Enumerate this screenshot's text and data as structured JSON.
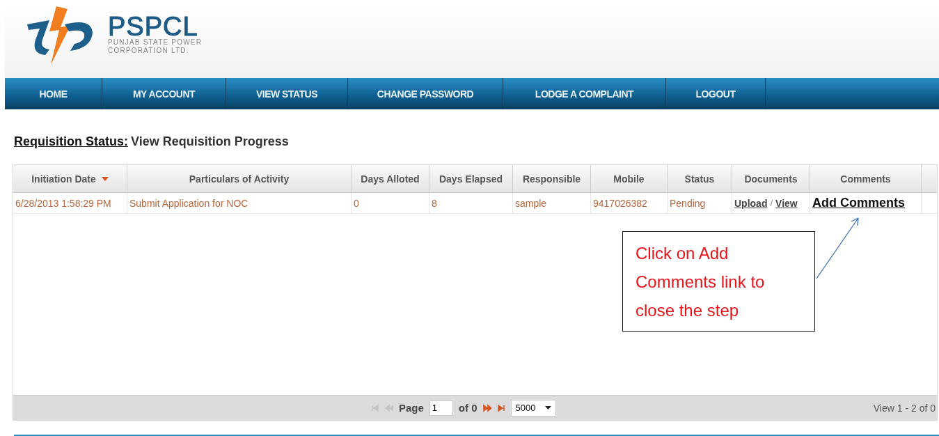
{
  "logo": {
    "name": "PSPCL",
    "subtitle_lines": [
      "PUNJAB STATE POWER",
      "CORPORATION LTD."
    ]
  },
  "nav": [
    {
      "label": "HOME"
    },
    {
      "label": "MY ACCOUNT"
    },
    {
      "label": "VIEW STATUS"
    },
    {
      "label": "CHANGE PASSWORD"
    },
    {
      "label": "LODGE A COMPLAINT"
    },
    {
      "label": "LOGOUT"
    }
  ],
  "page_title": {
    "label": "Requisition Status:",
    "text": "View Requisition Progress"
  },
  "table": {
    "columns": [
      {
        "label": "Initiation Date",
        "sorted": true
      },
      {
        "label": "Particulars of Activity",
        "sorted": false
      },
      {
        "label": "Days Alloted",
        "sorted": false
      },
      {
        "label": "Days Elapsed",
        "sorted": false
      },
      {
        "label": "Responsible",
        "sorted": false
      },
      {
        "label": "Mobile",
        "sorted": false
      },
      {
        "label": "Status",
        "sorted": false
      },
      {
        "label": "Documents",
        "sorted": false
      },
      {
        "label": "Comments",
        "sorted": false
      }
    ],
    "rows": [
      {
        "initiation_date": "6/28/2013 1:58:29 PM",
        "activity": "Submit Application for NOC",
        "days_alloted": "0",
        "days_elapsed": "8",
        "responsible": "sample",
        "mobile": "9417026382",
        "status": "Pending",
        "documents": [
          "Upload",
          "View"
        ],
        "documents_separator": "/",
        "comments": "Add Comments"
      }
    ]
  },
  "pager": {
    "buttons": [
      {
        "kind": "first",
        "disabled": true
      },
      {
        "kind": "prev",
        "disabled": true
      },
      {
        "kind": "next",
        "disabled": false
      },
      {
        "kind": "last",
        "disabled": false
      }
    ],
    "page_label": "Page",
    "page_value": "1",
    "of_label": "of 0",
    "page_size": "5000",
    "view_info": "View 1 - 2 of 0"
  },
  "callout": {
    "text": "Click on Add Comments link to close the step"
  }
}
